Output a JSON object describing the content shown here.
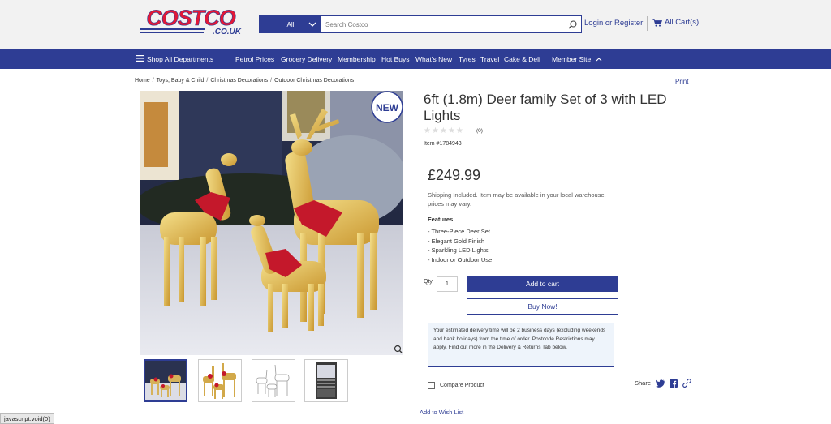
{
  "colors": {
    "brand_blue": "#2e3d94",
    "brand_red": "#e31837"
  },
  "header": {
    "logo_icon": "costco-logo",
    "logo_alt": "Costco",
    "search": {
      "category": "All",
      "placeholder": "Search Costco"
    },
    "account_label": "Login or Register",
    "cart_label": "All Cart(s)"
  },
  "nav": {
    "shop_all": "Shop All Departments",
    "items": [
      "Petrol Prices",
      "Grocery Delivery",
      "Membership",
      "Hot Buys",
      "What's New",
      "Tyres",
      "Travel",
      "Cake & Deli"
    ],
    "member_site": "Member Site"
  },
  "breadcrumbs": [
    "Home",
    "Toys, Baby & Child",
    "Christmas Decorations",
    "Outdoor Christmas Decorations"
  ],
  "print_label": "Print",
  "product": {
    "badge": "NEW",
    "title": "6ft (1.8m) Deer family Set of 3 with LED Lights",
    "rating_count": "(0)",
    "rating_value": 0,
    "item_number": "Item #1784943",
    "price": "£249.99",
    "shipping": "Shipping Included. Item may be available in your local warehouse, prices may vary.",
    "features_heading": "Features",
    "features": [
      "- Three-Piece Deer Set",
      "- Elegant Gold Finish",
      "- Sparkling LED Lights",
      "- Indoor or Outdoor Use"
    ],
    "qty_label": "Qty",
    "qty_value": "1",
    "add_to_cart": "Add to cart",
    "buy_now": "Buy Now!",
    "delivery_note": "Your estimated delivery time will be 2 business days (excluding weekends and bank holidays) from the time of order. Postcode Restrictions may apply. Find out more in the Delivery & Returns Tab below.",
    "compare_label": "Compare Product",
    "share_label": "Share",
    "wish_list": "Add to Wish List"
  },
  "status_bar": "javascript:void(0)"
}
